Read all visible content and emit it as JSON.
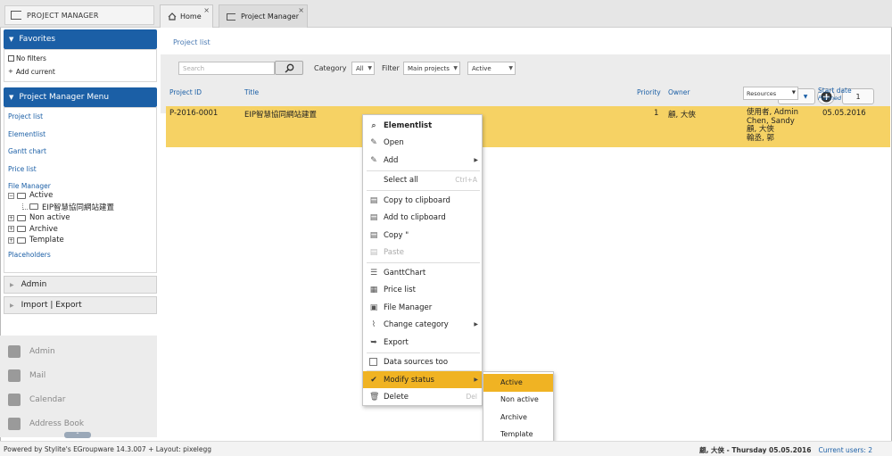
{
  "app": {
    "name": "PROJECT MANAGER"
  },
  "tabs": [
    {
      "label": "Home"
    },
    {
      "label": "Project Manager"
    }
  ],
  "tab_close": "×",
  "sidebar": {
    "favorites_title": "Favorites",
    "favorites": [
      "No filters",
      "Add current"
    ],
    "menu_title": "Project Manager Menu",
    "menu_links": [
      "Project list",
      "Elementlist",
      "Gantt chart",
      "Price list",
      "File Manager"
    ],
    "file_tree": {
      "active": "Active",
      "active_child": "EIP智慧協同網站建置",
      "non_active": "Non active",
      "archive": "Archive",
      "template": "Template"
    },
    "placeholders": "Placeholders",
    "sections": [
      "Admin",
      "Import | Export"
    ]
  },
  "apps": [
    {
      "label": "Admin",
      "icon": "wrench-icon"
    },
    {
      "label": "Mail",
      "icon": "mail-icon"
    },
    {
      "label": "Calendar",
      "icon": "calendar-icon"
    },
    {
      "label": "Address Book",
      "icon": "address-book-icon"
    }
  ],
  "main": {
    "breadcrumb": "Project list",
    "search_placeholder": "Search",
    "category_label": "Category",
    "category_value": "All",
    "filter_label": "Filter",
    "filter_value": "Main projects",
    "status_value": "Active",
    "page_num": "1",
    "columns": {
      "project_id": "Project ID",
      "title": "Title",
      "priority": "Priority",
      "owner": "Owner",
      "resources": "Resources",
      "start_date": "Start date",
      "start_sub": "Planned"
    },
    "row": {
      "project_id": "P-2016-0001",
      "title": "EIP智慧協同網站建置",
      "priority": "1",
      "owner": "顧, 大俠",
      "resources": [
        "使用者, Admin",
        "Chen, Sandy",
        "顧, 大俠",
        "翰丞, 郭"
      ],
      "start_date": "05.05.2016"
    },
    "highlight_color": "#f6d264"
  },
  "context_menu": {
    "elementlist": "Elementlist",
    "open": "Open",
    "add": "Add",
    "select_all": "Select all",
    "select_all_shortcut": "Ctrl+A",
    "copy_clipboard": "Copy to clipboard",
    "add_clipboard": "Add to clipboard",
    "copy": "Copy \"",
    "paste": "Paste",
    "ganttchart": "GanttChart",
    "price_list": "Price list",
    "file_manager": "File Manager",
    "change_category": "Change category",
    "export": "Export",
    "data_sources": "Data sources too",
    "modify_status": "Modify status",
    "delete": "Delete",
    "delete_shortcut": "Del"
  },
  "submenu": [
    "Active",
    "Non active",
    "Archive",
    "Template"
  ],
  "footer": {
    "powered": "Powered by Stylite's EGroupware 14.3.007 + Layout: pixelegg",
    "user_date": "顧, 大俠 - Thursday 05.05.2016",
    "current_users": "Current users: 2"
  },
  "colors": {
    "brand": "#1b5fa6",
    "menu_hover": "#f0b323"
  }
}
